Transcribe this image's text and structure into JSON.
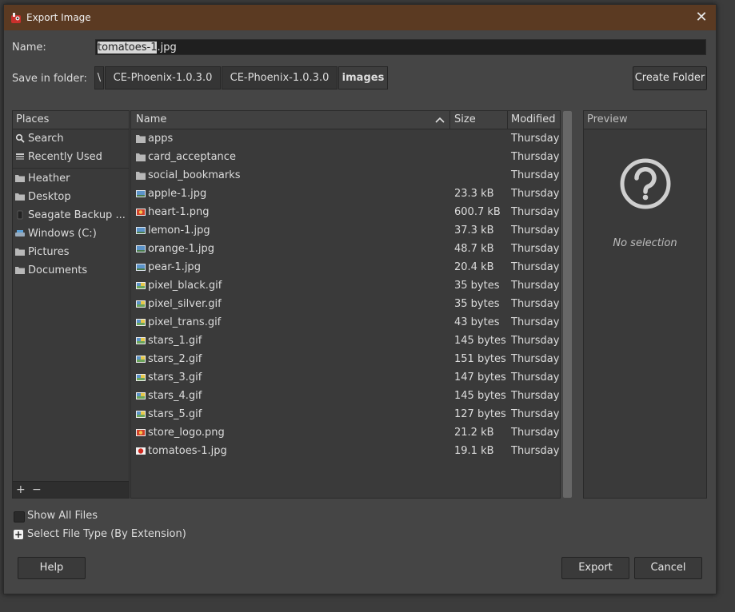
{
  "window": {
    "title": "Export Image"
  },
  "name_field": {
    "label": "Name:",
    "selected_part": "tomatoes-1",
    "rest_part": ".jpg"
  },
  "folder": {
    "label": "Save in folder:",
    "crumbs": [
      "\\",
      "CE-Phoenix-1.0.3.0",
      "CE-Phoenix-1.0.3.0",
      "images"
    ],
    "create_folder_label": "Create Folder"
  },
  "places": {
    "header": "Places",
    "items": [
      {
        "label": "Search",
        "icon": "search-icon"
      },
      {
        "label": "Recently Used",
        "icon": "clock-icon"
      },
      {
        "label": "Heather",
        "icon": "folder-icon"
      },
      {
        "label": "Desktop",
        "icon": "folder-icon"
      },
      {
        "label": "Seagate Backup ...",
        "icon": "drive-icon"
      },
      {
        "label": "Windows (C:)",
        "icon": "drive-icon"
      },
      {
        "label": "Pictures",
        "icon": "folder-icon"
      },
      {
        "label": "Documents",
        "icon": "folder-icon"
      }
    ],
    "add": "+",
    "remove": "−"
  },
  "files": {
    "columns": {
      "name": "Name",
      "size": "Size",
      "modified": "Modified"
    },
    "sort_indicator": "^",
    "rows": [
      {
        "name": "apps",
        "size": "",
        "modified": "Thursday",
        "icon": "folder"
      },
      {
        "name": "card_acceptance",
        "size": "",
        "modified": "Thursday",
        "icon": "folder"
      },
      {
        "name": "social_bookmarks",
        "size": "",
        "modified": "Thursday",
        "icon": "folder"
      },
      {
        "name": "apple-1.jpg",
        "size": "23.3 kB",
        "modified": "Thursday",
        "icon": "image"
      },
      {
        "name": "heart-1.png",
        "size": "600.7 kB",
        "modified": "Thursday",
        "icon": "image-red"
      },
      {
        "name": "lemon-1.jpg",
        "size": "37.3 kB",
        "modified": "Thursday",
        "icon": "image"
      },
      {
        "name": "orange-1.jpg",
        "size": "48.7 kB",
        "modified": "Thursday",
        "icon": "image"
      },
      {
        "name": "pear-1.jpg",
        "size": "20.4 kB",
        "modified": "Thursday",
        "icon": "image"
      },
      {
        "name": "pixel_black.gif",
        "size": "35 bytes",
        "modified": "Thursday",
        "icon": "image-gif"
      },
      {
        "name": "pixel_silver.gif",
        "size": "35 bytes",
        "modified": "Thursday",
        "icon": "image-gif"
      },
      {
        "name": "pixel_trans.gif",
        "size": "43 bytes",
        "modified": "Thursday",
        "icon": "image-gif"
      },
      {
        "name": "stars_1.gif",
        "size": "145 bytes",
        "modified": "Thursday",
        "icon": "image-gif"
      },
      {
        "name": "stars_2.gif",
        "size": "151 bytes",
        "modified": "Thursday",
        "icon": "image-gif"
      },
      {
        "name": "stars_3.gif",
        "size": "147 bytes",
        "modified": "Thursday",
        "icon": "image-gif"
      },
      {
        "name": "stars_4.gif",
        "size": "145 bytes",
        "modified": "Thursday",
        "icon": "image-gif"
      },
      {
        "name": "stars_5.gif",
        "size": "127 bytes",
        "modified": "Thursday",
        "icon": "image-gif"
      },
      {
        "name": "store_logo.png",
        "size": "21.2 kB",
        "modified": "Thursday",
        "icon": "image-red"
      },
      {
        "name": "tomatoes-1.jpg",
        "size": "19.1 kB",
        "modified": "Thursday",
        "icon": "image-tomato"
      }
    ]
  },
  "preview": {
    "header": "Preview",
    "empty_text": "No selection",
    "icon": "question-icon"
  },
  "options": {
    "show_all_files": "Show All Files",
    "select_file_type": "Select File Type (By Extension)"
  },
  "buttons": {
    "help": "Help",
    "export": "Export",
    "cancel": "Cancel"
  },
  "colors": {
    "titlebar": "#5b3a22",
    "background": "#454545",
    "panel": "#3a3a3a",
    "text": "#dcdcdc"
  }
}
